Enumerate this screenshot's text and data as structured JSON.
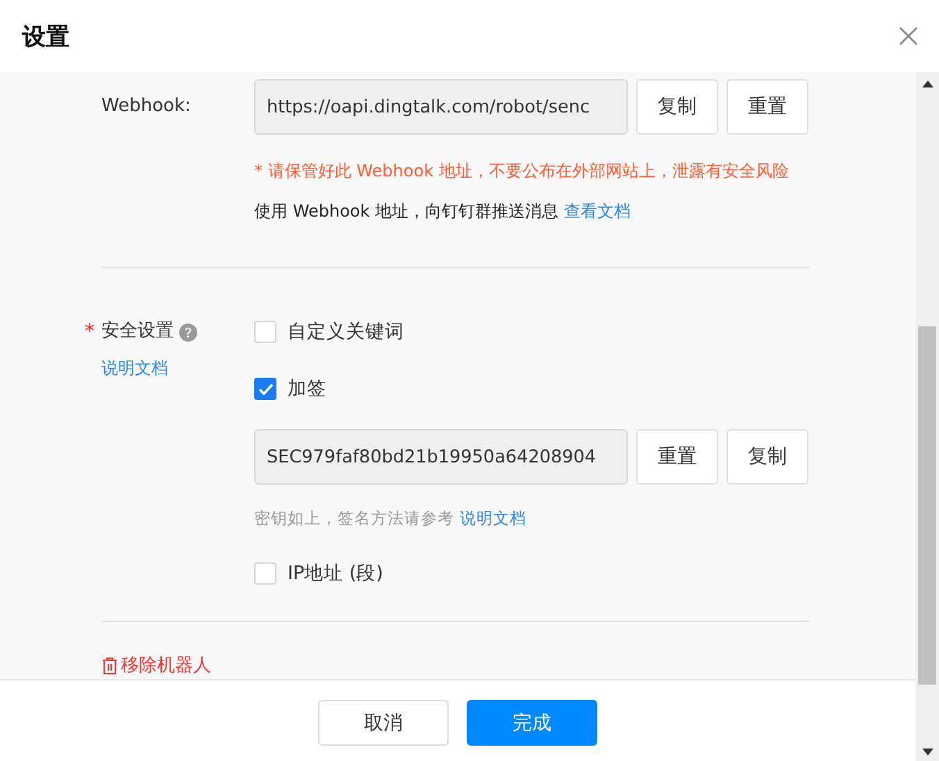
{
  "dialog": {
    "title": "设置"
  },
  "webhook": {
    "label": "Webhook:",
    "value": "https://oapi.dingtalk.com/robot/senc",
    "buttons": [
      "复制",
      "重置"
    ],
    "warning": "* 请保管好此 Webhook 地址，不要公布在外部网站上，泄露有安全风险",
    "info": "使用 Webhook 地址，向钉钉群推送消息",
    "info_link": "查看文档"
  },
  "security": {
    "label": "安全设置",
    "required_mark": "*",
    "doc_link": "说明文档",
    "options": [
      {
        "label": "自定义关键词",
        "checked": false
      },
      {
        "label": "加签",
        "checked": true,
        "secret": {
          "value": "SEC979faf80bd21b19950a64208904",
          "buttons": [
            "重置",
            "复制"
          ],
          "hint": "密钥如上，签名方法请参考",
          "hint_link": "说明文档"
        }
      },
      {
        "label": "IP地址 (段)",
        "checked": false
      }
    ]
  },
  "remove_link": "移除机器人",
  "footer": {
    "buttons": [
      {
        "label": "取消",
        "kind": "default"
      },
      {
        "label": "完成",
        "kind": "primary"
      }
    ]
  }
}
